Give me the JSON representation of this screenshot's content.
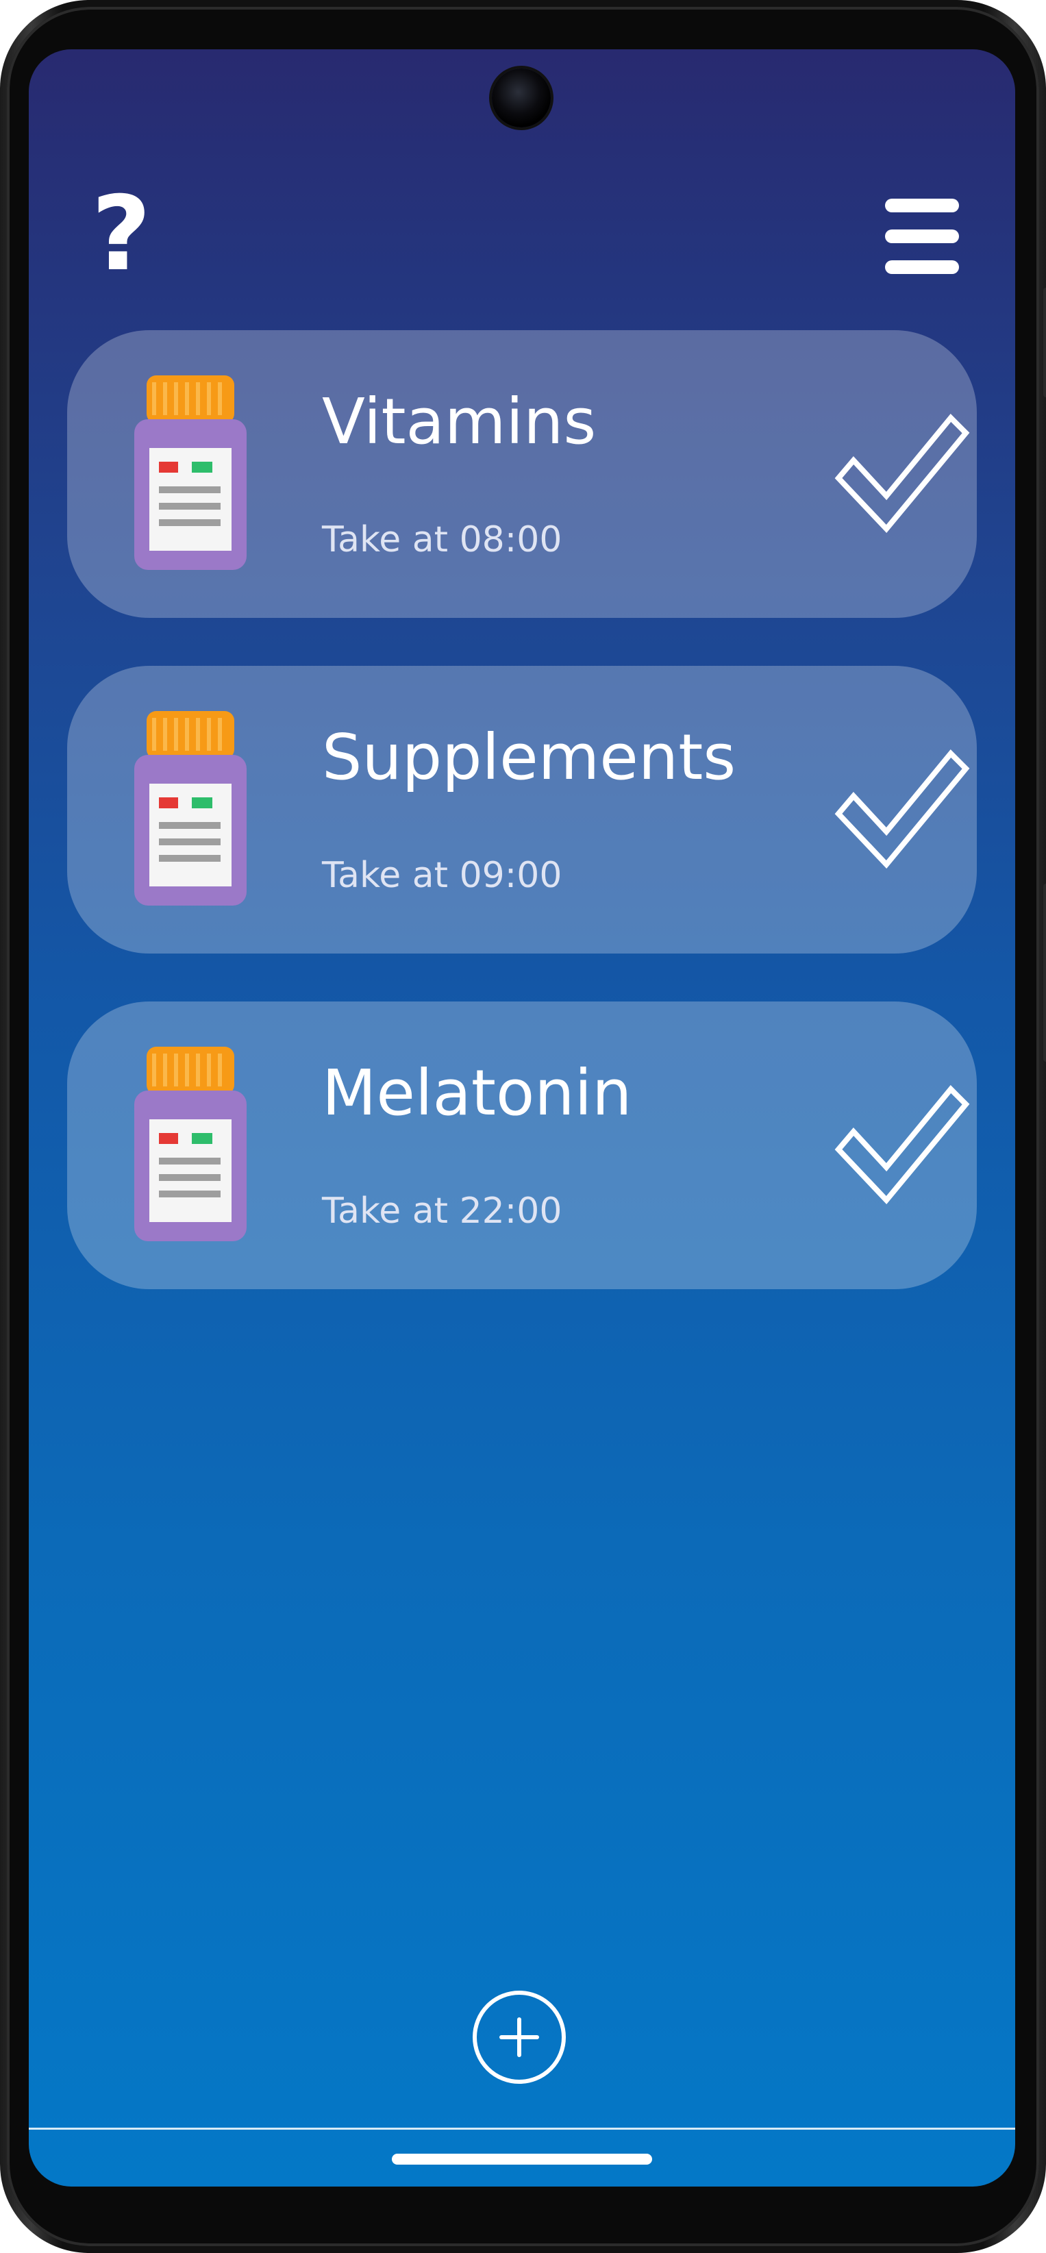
{
  "header": {
    "help_icon": "help-icon",
    "help_glyph": "?",
    "menu_icon": "hamburger-menu-icon"
  },
  "medications": [
    {
      "name": "Vitamins",
      "schedule": "Take at 08:00",
      "icon": "pill-bottle-icon",
      "status_icon": "checkmark-icon"
    },
    {
      "name": "Supplements",
      "schedule": "Take at 09:00",
      "icon": "pill-bottle-icon",
      "status_icon": "checkmark-icon"
    },
    {
      "name": "Melatonin",
      "schedule": "Take at 22:00",
      "icon": "pill-bottle-icon",
      "status_icon": "checkmark-icon"
    }
  ],
  "footer": {
    "add_icon": "plus-circle-icon"
  },
  "colors": {
    "gradient_top": "#282a70",
    "gradient_bottom": "#0478c7",
    "bottle_body": "#9b79c8",
    "bottle_cap": "#f79a16",
    "label_red": "#e53935",
    "label_green": "#2ebd6b",
    "text_primary": "#ffffff"
  }
}
